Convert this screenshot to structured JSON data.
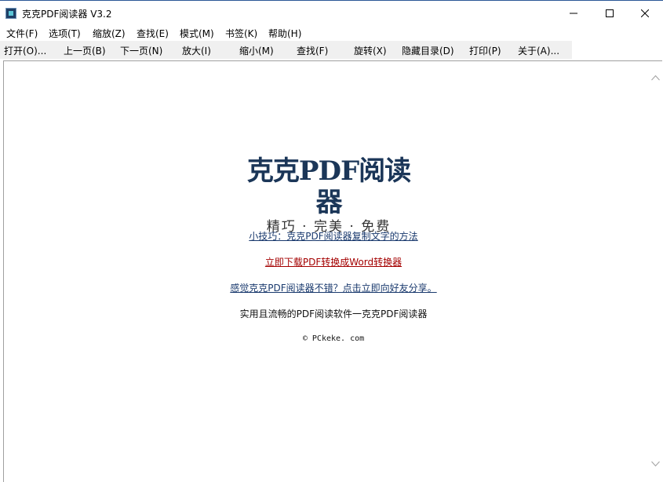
{
  "window": {
    "title": "克克PDF阅读器 V3.2"
  },
  "menubar": {
    "items": [
      {
        "label": "文件(F)"
      },
      {
        "label": "选项(T)"
      },
      {
        "label": "缩放(Z)"
      },
      {
        "label": "查找(E)"
      },
      {
        "label": "模式(M)"
      },
      {
        "label": "书签(K)"
      },
      {
        "label": "帮助(H)"
      }
    ]
  },
  "toolbar": {
    "items": [
      {
        "label": "打开(O)..."
      },
      {
        "label": "上一页(B)"
      },
      {
        "label": "下一页(N)"
      },
      {
        "label": "放大(I)"
      },
      {
        "label": "缩小(M)"
      },
      {
        "label": "查找(F)"
      },
      {
        "label": "旋转(X)"
      },
      {
        "label": "隐藏目录(D)"
      },
      {
        "label": "打印(P)"
      },
      {
        "label": "关于(A)..."
      }
    ]
  },
  "content": {
    "logo_title": "克克PDF阅读器",
    "logo_slogan": "精巧 · 完美 · 免费",
    "tip_link": "小技巧：克克PDF阅读器复制文字的方法",
    "download_link": "立即下载PDF转换成Word转换器",
    "share_link": "感觉克克PDF阅读器不错？点击立即向好友分享。",
    "description": "实用且流畅的PDF阅读软件一克克PDF阅读器",
    "copyright": "© PCkeke. com"
  },
  "colors": {
    "link_blue": "#1a3a6e",
    "link_red": "#a40000",
    "logo_navy": "#1b3658"
  }
}
